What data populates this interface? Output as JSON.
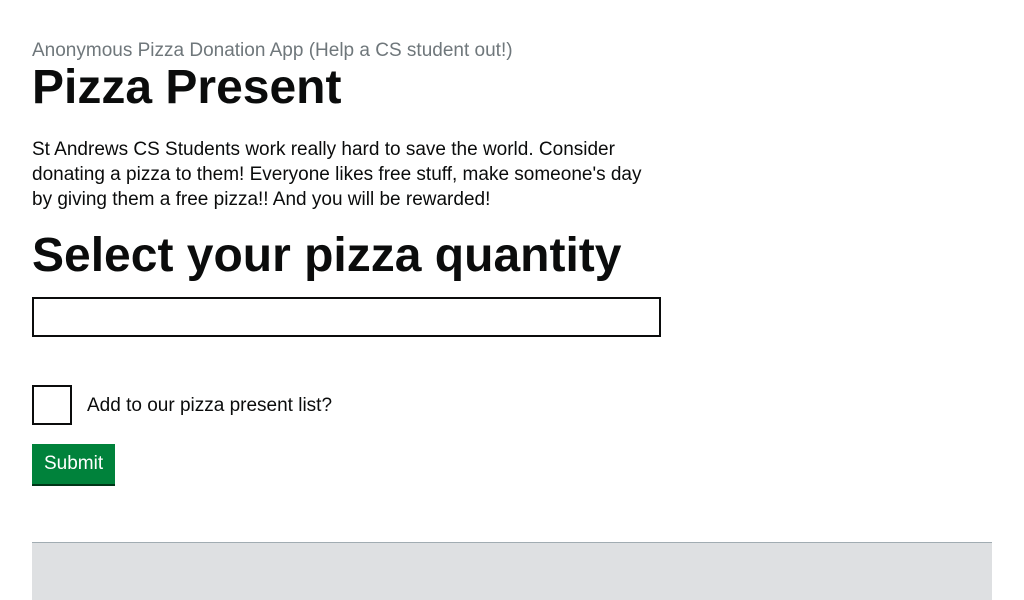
{
  "header": {
    "caption": "Anonymous Pizza Donation App (Help a CS student out!)",
    "title": "Pizza Present"
  },
  "main": {
    "description": "St Andrews CS Students work really hard to save the world. Consider donating a pizza to them! Everyone likes free stuff, make someone's day by giving them a free pizza!! And you will be rewarded!",
    "quantity_heading": "Select your pizza quantity",
    "quantity_input": {
      "value": "",
      "placeholder": ""
    },
    "add_to_list_checkbox": {
      "label": "Add to our pizza present list?",
      "checked": false
    },
    "submit_label": "Submit"
  },
  "colors": {
    "submit_background": "#00823b",
    "caption_text": "#6f777b",
    "footer_background": "#dee0e2"
  }
}
